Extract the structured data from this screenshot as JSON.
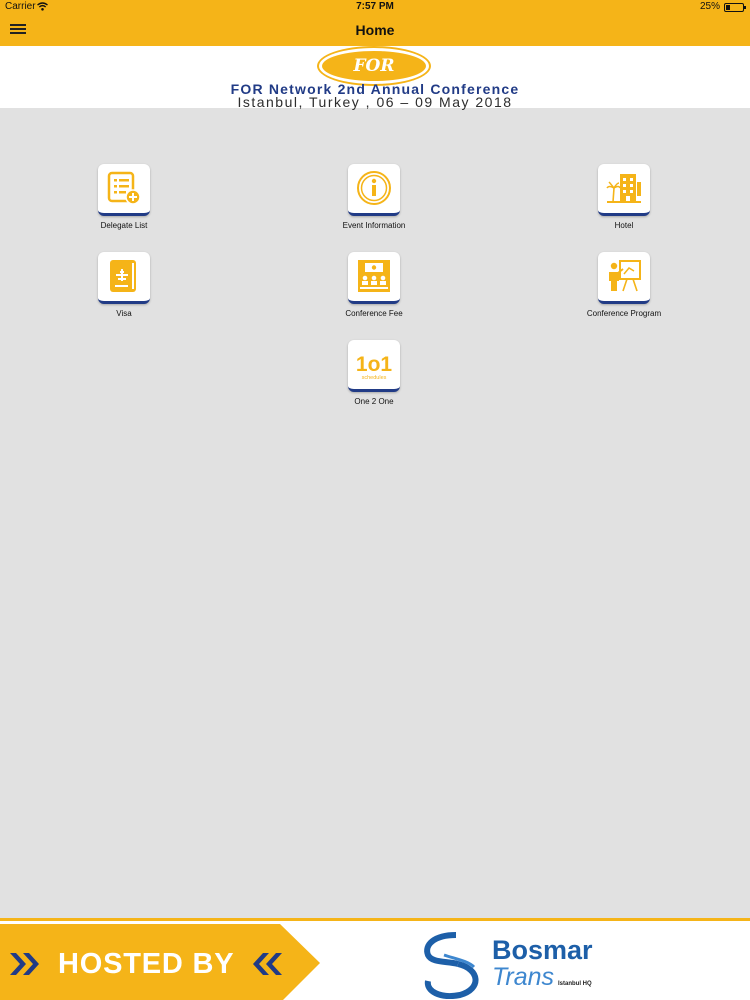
{
  "status_bar": {
    "carrier": "Carrier",
    "time": "7:57 PM",
    "battery": "25%",
    "battery_level": 0.25
  },
  "nav": {
    "title": "Home"
  },
  "banner": {
    "logo_text": "FOR",
    "headline": "FOR Network 2nd Annual Conference",
    "subline": "Istanbul, Turkey , 06 – 09 May  2018"
  },
  "menu": {
    "items": [
      {
        "label": "Delegate List",
        "icon": "delegate-list-icon"
      },
      {
        "label": "Event Information",
        "icon": "info-icon"
      },
      {
        "label": "Hotel",
        "icon": "hotel-icon"
      },
      {
        "label": "Visa",
        "icon": "passport-icon"
      },
      {
        "label": "Conference Fee",
        "icon": "conference-fee-icon"
      },
      {
        "label": "Conference Program",
        "icon": "presentation-icon"
      },
      {
        "label": "One 2 One",
        "icon": "one-to-one-icon",
        "icon_text": "1o1",
        "icon_caption": "schedules"
      }
    ]
  },
  "footer": {
    "hosted_by": "HOSTED BY",
    "brand_name_1": "Bosmar",
    "brand_name_2": "Trans",
    "brand_tagline": "Istanbul HQ"
  },
  "colors": {
    "accent": "#f5b418",
    "navy": "#213b86",
    "background": "#e1e1e1"
  }
}
